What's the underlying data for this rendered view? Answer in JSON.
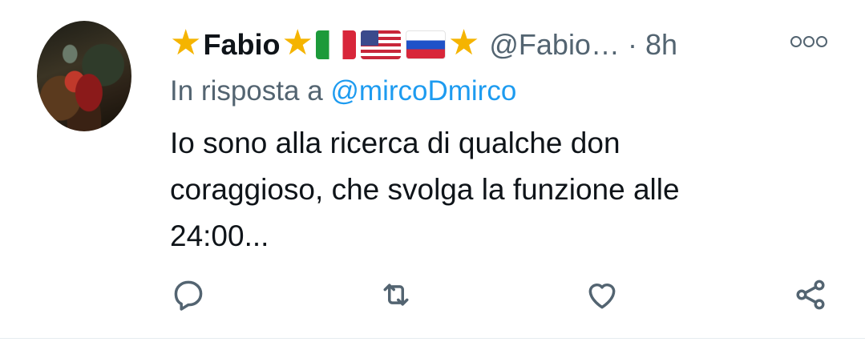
{
  "header": {
    "display_name": "Fabio",
    "name_decorations": [
      "star",
      "star",
      "flag-italy",
      "flag-usa",
      "flag-russia",
      "star"
    ],
    "handle": "@Fabio…",
    "separator": "·",
    "timestamp": "8h"
  },
  "reply_context": {
    "prefix": "In risposta a",
    "mention": "@mircoDmirco"
  },
  "body_lines": [
    "Io sono alla ricerca di qualche don",
    "coraggioso, che svolga la funzione alle",
    "24:00..."
  ],
  "actions": [
    "reply-icon",
    "retweet-icon",
    "like-icon",
    "share-icon"
  ],
  "colors": {
    "text": "#0f1419",
    "muted": "#536471",
    "link": "#1d9bf0",
    "star": "#f5b400"
  }
}
